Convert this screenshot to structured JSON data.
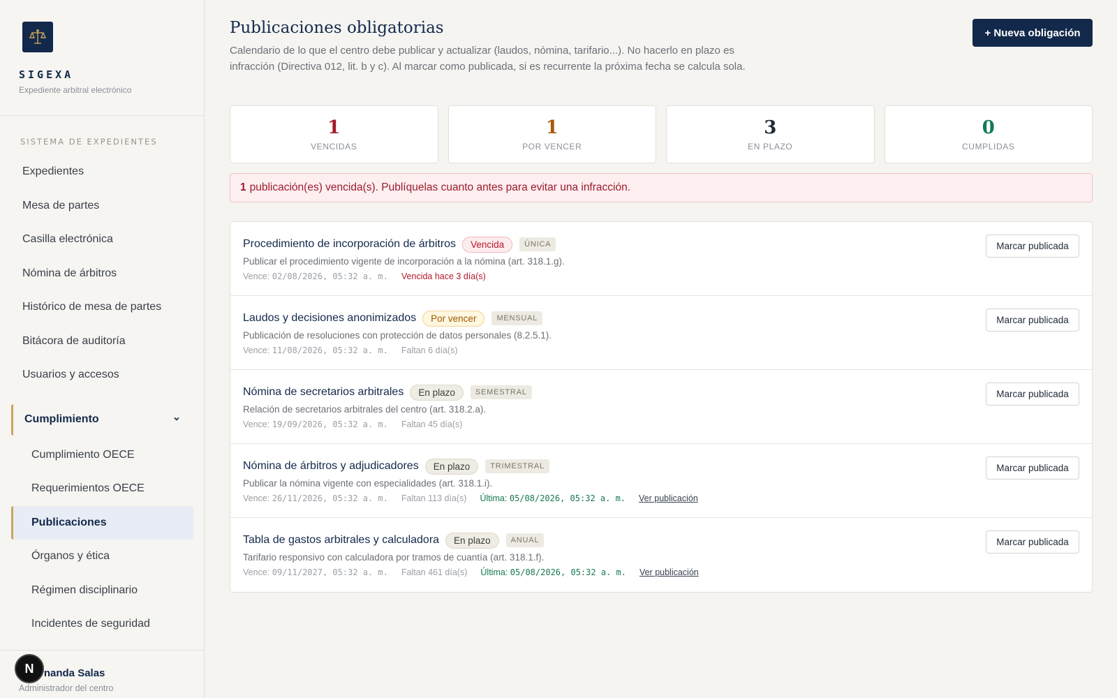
{
  "brand": {
    "name": "SIGEXA",
    "subtitle": "Expediente arbitral electrónico"
  },
  "sidebar": {
    "section_label": "SISTEMA DE EXPEDIENTES",
    "items": [
      {
        "label": "Expedientes"
      },
      {
        "label": "Mesa de partes"
      },
      {
        "label": "Casilla electrónica"
      },
      {
        "label": "Nómina de árbitros"
      },
      {
        "label": "Histórico de mesa de partes"
      },
      {
        "label": "Bitácora de auditoría"
      },
      {
        "label": "Usuarios y accesos"
      }
    ],
    "group": {
      "label": "Cumplimiento",
      "items": [
        {
          "label": "Cumplimiento OECE"
        },
        {
          "label": "Requerimientos OECE"
        },
        {
          "label": "Publicaciones"
        },
        {
          "label": "Órganos y ética"
        },
        {
          "label": "Régimen disciplinario"
        },
        {
          "label": "Incidentes de seguridad"
        }
      ]
    },
    "user": {
      "name": "a Fernanda Salas",
      "role": "Administrador del centro",
      "fab_letter": "N"
    }
  },
  "page": {
    "title": "Publicaciones obligatorias",
    "description": "Calendario de lo que el centro debe publicar y actualizar (laudos, nómina, tarifario...). No hacerlo en plazo es infracción (Directiva 012, lit. b y c). Al marcar como publicada, si es recurrente la próxima fecha se calcula sola.",
    "new_button": "+ Nueva obligación"
  },
  "stats": [
    {
      "value": "1",
      "label": "VENCIDAS",
      "color": "#a31b2b"
    },
    {
      "value": "1",
      "label": "POR VENCER",
      "color": "#a8590c"
    },
    {
      "value": "3",
      "label": "EN PLAZO",
      "color": "#1f2937"
    },
    {
      "value": "0",
      "label": "CUMPLIDAS",
      "color": "#137a55"
    }
  ],
  "alert": {
    "count": "1",
    "text": "publicación(es) vencida(s). Publíquelas cuanto antes para evitar una infracción."
  },
  "publications": [
    {
      "title": "Procedimiento de incorporación de árbitros",
      "status": "Vencida",
      "frequency": "ÚNICA",
      "description": "Publicar el procedimiento vigente de incorporación a la nómina (art. 318.1.g).",
      "due_label": "Vence:",
      "due": "02/08/2026, 05:32 a. m.",
      "remaining": "Vencida hace 3 día(s)",
      "last_label": "",
      "last": "",
      "link": "",
      "button": "Marcar publicada"
    },
    {
      "title": "Laudos y decisiones anonimizados",
      "status": "Por vencer",
      "frequency": "MENSUAL",
      "description": "Publicación de resoluciones con protección de datos personales (8.2.5.1).",
      "due_label": "Vence:",
      "due": "11/08/2026, 05:32 a. m.",
      "remaining": "Faltan 6 día(s)",
      "last_label": "",
      "last": "",
      "link": "",
      "button": "Marcar publicada"
    },
    {
      "title": "Nómina de secretarios arbitrales",
      "status": "En plazo",
      "frequency": "SEMESTRAL",
      "description": "Relación de secretarios arbitrales del centro (art. 318.2.a).",
      "due_label": "Vence:",
      "due": "19/09/2026, 05:32 a. m.",
      "remaining": "Faltan 45 día(s)",
      "last_label": "",
      "last": "",
      "link": "",
      "button": "Marcar publicada"
    },
    {
      "title": "Nómina de árbitros y adjudicadores",
      "status": "En plazo",
      "frequency": "TRIMESTRAL",
      "description": "Publicar la nómina vigente con especialidades (art. 318.1.i).",
      "due_label": "Vence:",
      "due": "26/11/2026, 05:32 a. m.",
      "remaining": "Faltan 113 día(s)",
      "last_label": "Última:",
      "last": "05/08/2026, 05:32 a. m.",
      "link": "Ver publicación",
      "button": "Marcar publicada"
    },
    {
      "title": "Tabla de gastos arbitrales y calculadora",
      "status": "En plazo",
      "frequency": "ANUAL",
      "description": "Tarifario responsivo con calculadora por tramos de cuantía (art. 318.1.f).",
      "due_label": "Vence:",
      "due": "09/11/2027, 05:32 a. m.",
      "remaining": "Faltan 461 día(s)",
      "last_label": "Última:",
      "last": "05/08/2026, 05:32 a. m.",
      "link": "Ver publicación",
      "button": "Marcar publicada"
    }
  ],
  "icons": {
    "logo": "scales-icon",
    "group_toggle": "chevron-down-icon"
  }
}
